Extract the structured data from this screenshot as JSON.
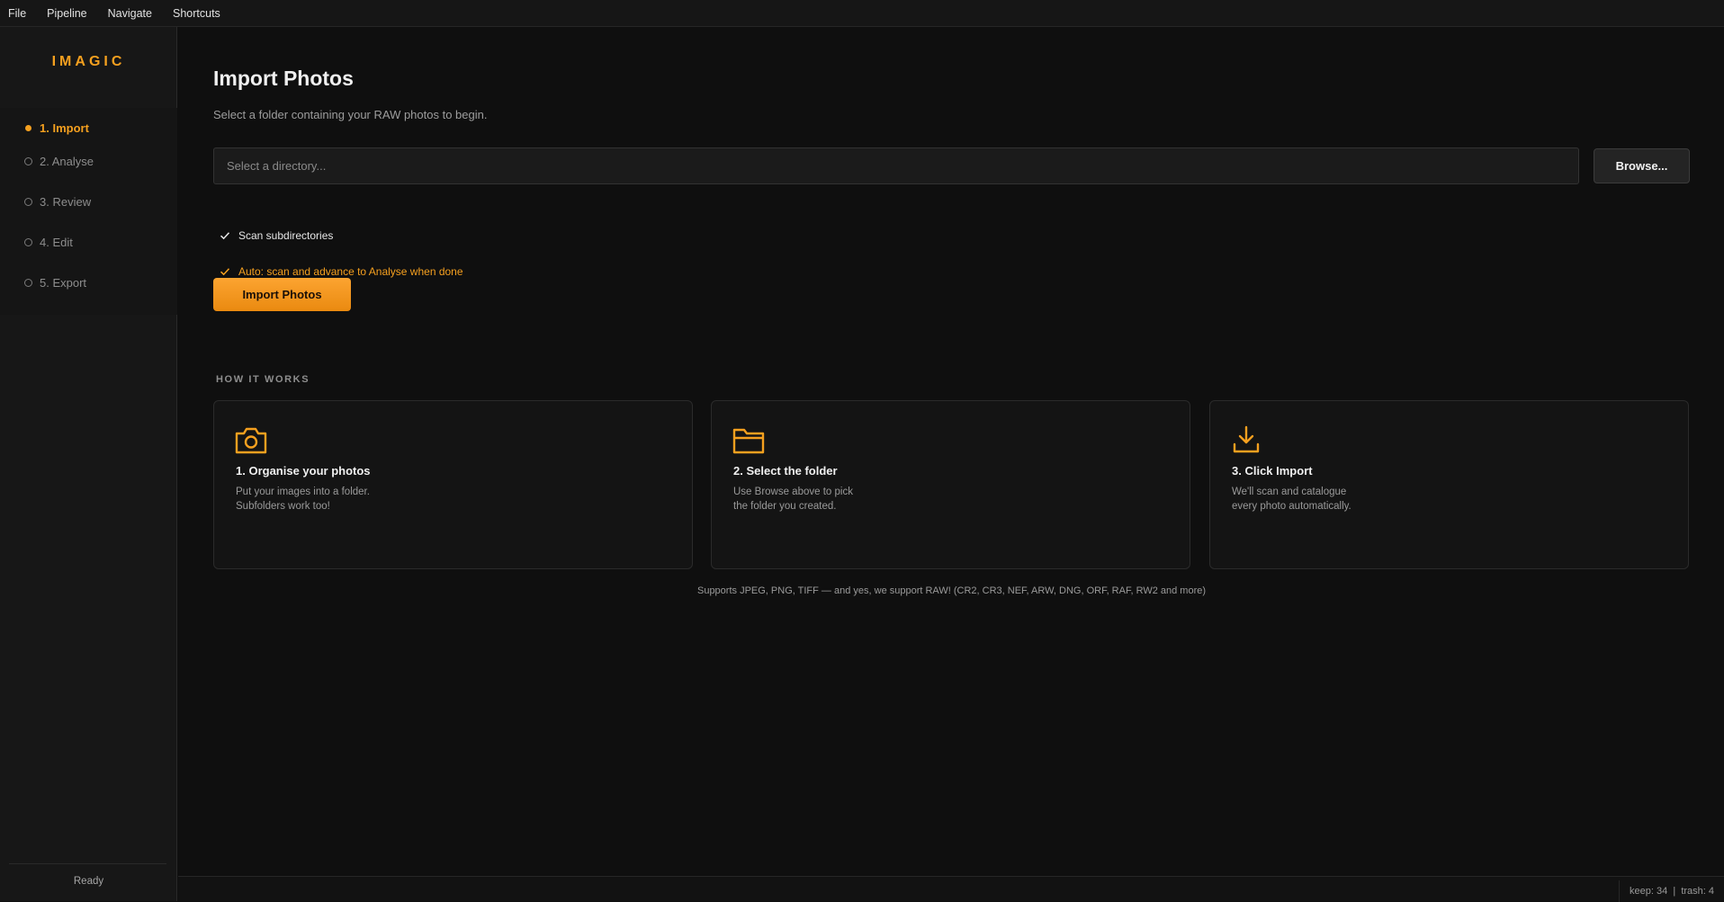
{
  "menubar": {
    "items": [
      "File",
      "Pipeline",
      "Navigate",
      "Shortcuts"
    ]
  },
  "sidebar": {
    "logo": "IMAGIC",
    "items": [
      {
        "label": "1. Import",
        "active": true
      },
      {
        "label": "2. Analyse",
        "active": false
      },
      {
        "label": "3. Review",
        "active": false
      },
      {
        "label": "4. Edit",
        "active": false
      },
      {
        "label": "5. Export",
        "active": false
      }
    ],
    "status": "Ready"
  },
  "main": {
    "title": "Import Photos",
    "subtitle": "Select a folder containing your RAW photos to begin.",
    "directory": {
      "value": "",
      "placeholder": "Select a directory..."
    },
    "browse_label": "Browse...",
    "scan_subdirectories": {
      "label": "Scan subdirectories",
      "checked": true
    },
    "auto_advance": {
      "label": "Auto: scan and advance to Analyse when done",
      "checked": true
    },
    "import_label": "Import Photos",
    "how_it_works": {
      "heading": "HOW IT WORKS",
      "cards": [
        {
          "icon": "camera-icon",
          "title": "1. Organise your photos",
          "desc1": "Put your images into a folder.",
          "desc2": "Subfolders work too!"
        },
        {
          "icon": "folder-icon",
          "title": "2. Select the folder",
          "desc1": "Use Browse above to pick",
          "desc2": "the folder you created."
        },
        {
          "icon": "download-icon",
          "title": "3. Click Import",
          "desc1": "We'll scan and catalogue",
          "desc2": "every photo automatically."
        }
      ]
    },
    "support_note": "Supports JPEG, PNG, TIFF — and yes, we support RAW! (CR2, CR3, NEF, ARW, DNG, ORF, RAF, RW2 and more)"
  },
  "statusbar": {
    "counts": "keep: 34  |  trash: 4"
  },
  "colors": {
    "accent": "#f5a01f",
    "background": "#0f0f0f",
    "sidebar": "#171717"
  }
}
